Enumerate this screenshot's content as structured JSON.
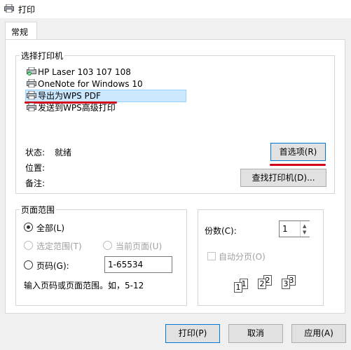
{
  "window": {
    "title": "打印"
  },
  "tab": {
    "label": "常规"
  },
  "select_printer": {
    "legend": "选择打印机",
    "printers": [
      {
        "label": "HP Laser 103 107 108",
        "icon": "printer-default-icon"
      },
      {
        "label": "OneNote for Windows 10",
        "icon": "printer-icon"
      },
      {
        "label": "导出为WPS PDF",
        "icon": "printer-icon",
        "selected": true
      },
      {
        "label": "发送到WPS高级打印",
        "icon": "printer-icon"
      }
    ],
    "status_label": "状态:",
    "status_value": "就绪",
    "location_label": "位置:",
    "comment_label": "备注:",
    "preferences_button": "首选项(R)",
    "find_printer_button": "查找打印机(D)..."
  },
  "page_range": {
    "legend": "页面范围",
    "all": "全部(L)",
    "selection": "选定范围(T)",
    "current_page": "当前页面(U)",
    "pages": "页码(G):",
    "pages_value": "1-65534",
    "hint": "输入页码或页面范围。如，5-12",
    "selected_option": "all"
  },
  "copies": {
    "label": "份数(C):",
    "value": "1",
    "collate_label": "自动分页(O)",
    "collate_checked": false,
    "collate_pages": [
      "1",
      "1",
      "2",
      "2",
      "3",
      "3"
    ]
  },
  "buttons": {
    "print": "打印(P)",
    "cancel": "取消",
    "apply": "应用(A)"
  },
  "colors": {
    "annotation_red": "#d4001a",
    "selection_blue": "#cce8ff",
    "focus_blue": "#0078d7"
  }
}
